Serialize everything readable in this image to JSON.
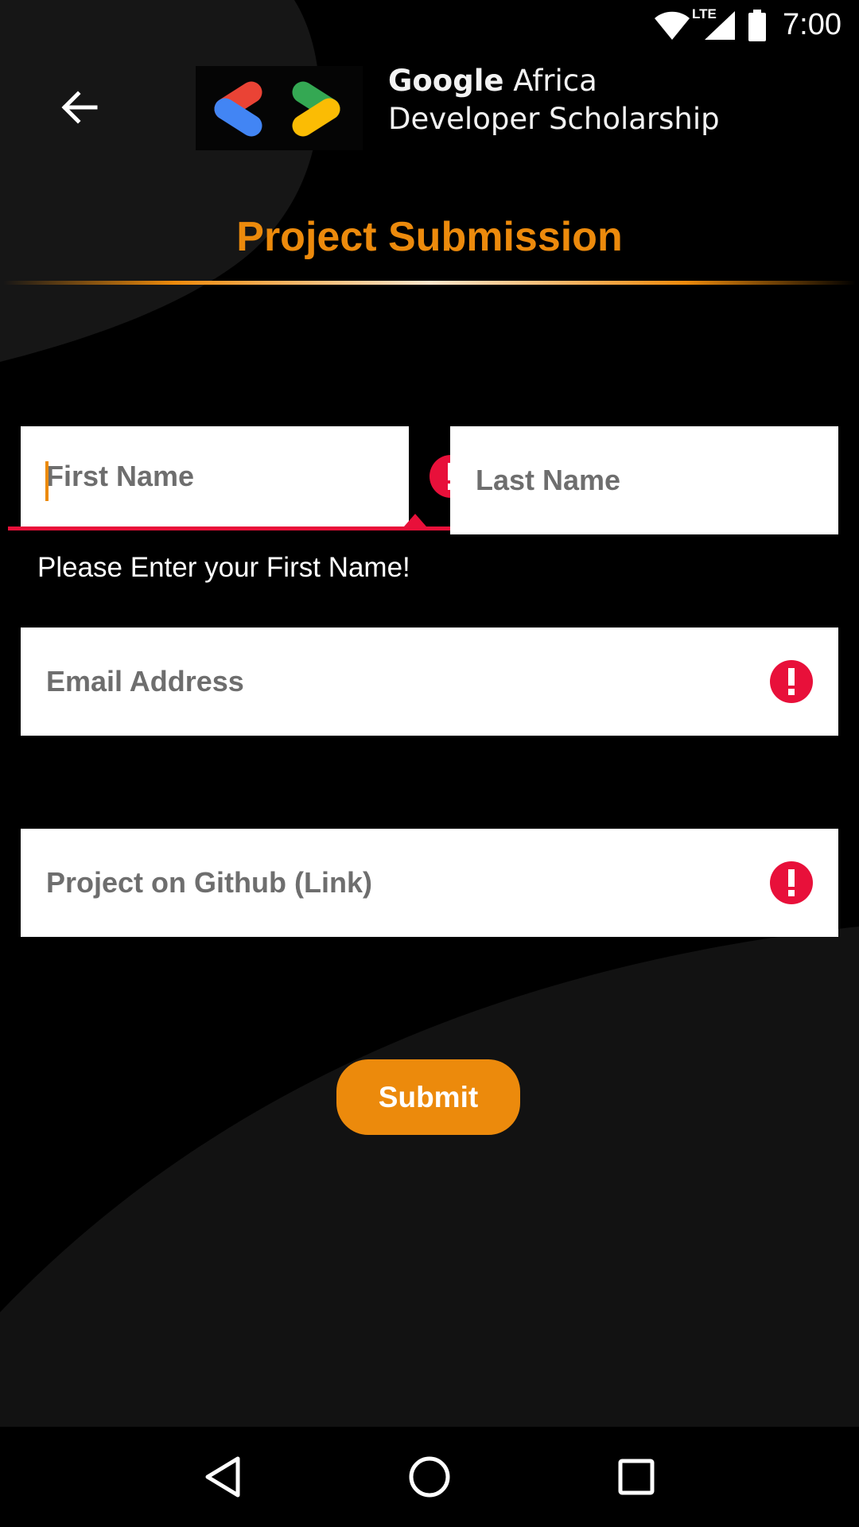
{
  "status_bar": {
    "time": "7:00",
    "network": "LTE",
    "icons": [
      "wifi-icon",
      "signal-icon",
      "battery-icon"
    ]
  },
  "header": {
    "back_icon": "arrow-left-icon",
    "brand_line1_strong": "Google",
    "brand_line1_rest": " Africa",
    "brand_line2": "Developer Scholarship",
    "title": "Project Submission"
  },
  "form": {
    "first_name": {
      "placeholder": "First Name",
      "value": ""
    },
    "last_name": {
      "placeholder": "Last Name",
      "value": ""
    },
    "error_message": "Please Enter your First Name!",
    "email": {
      "placeholder": "Email Address",
      "value": ""
    },
    "github": {
      "placeholder": "Project on Github (Link)",
      "value": ""
    },
    "error_icon": "exclamation-icon",
    "submit_label": "Submit"
  },
  "colors": {
    "accent": "#ec8a0c",
    "error": "#e8103a",
    "background": "#000000",
    "background_shape": "#121212",
    "logo_red": "#ea4335",
    "logo_blue": "#4285f4",
    "logo_green": "#34a853",
    "logo_yellow": "#fbbc04"
  },
  "nav_bar": {
    "buttons": [
      "back-triangle-icon",
      "home-circle-icon",
      "recents-square-icon"
    ]
  }
}
